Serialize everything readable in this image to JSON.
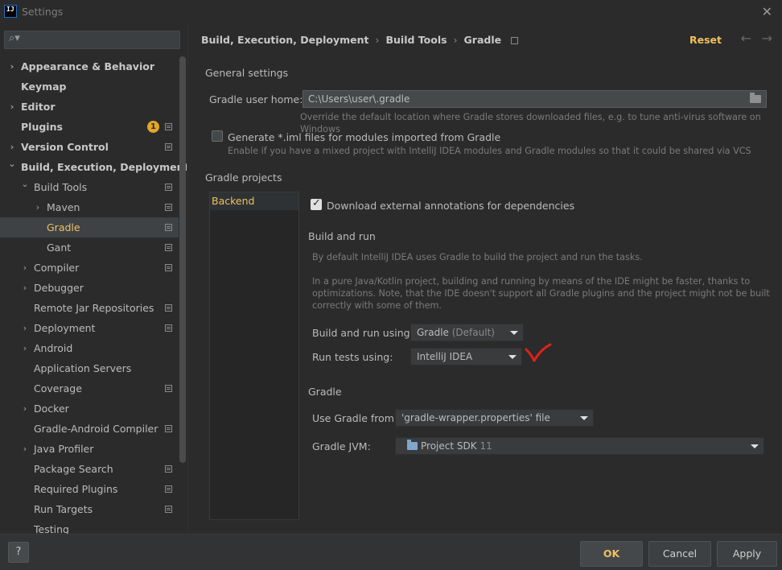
{
  "window": {
    "title": "Settings",
    "logo_text": "IJ"
  },
  "sidebar": {
    "items": [
      {
        "label": "Appearance & Behavior",
        "bold": true,
        "chevron": "right",
        "level": 0
      },
      {
        "label": "Keymap",
        "bold": true,
        "chevron": "",
        "level": 0
      },
      {
        "label": "Editor",
        "bold": true,
        "chevron": "right",
        "level": 0
      },
      {
        "label": "Plugins",
        "bold": true,
        "chevron": "",
        "level": 0,
        "badge": "1",
        "project": true
      },
      {
        "label": "Version Control",
        "bold": true,
        "chevron": "right",
        "level": 0,
        "project": true
      },
      {
        "label": "Build, Execution, Deployment",
        "bold": true,
        "chevron": "down",
        "level": 0
      },
      {
        "label": "Build Tools",
        "chevron": "down",
        "level": 1,
        "project": true
      },
      {
        "label": "Maven",
        "chevron": "right",
        "level": 2,
        "project": true
      },
      {
        "label": "Gradle",
        "chevron": "",
        "level": 2,
        "project": true,
        "selected": true
      },
      {
        "label": "Gant",
        "chevron": "",
        "level": 2,
        "project": true
      },
      {
        "label": "Compiler",
        "chevron": "right",
        "level": 1,
        "project": true
      },
      {
        "label": "Debugger",
        "chevron": "right",
        "level": 1
      },
      {
        "label": "Remote Jar Repositories",
        "chevron": "",
        "level": 1,
        "project": true
      },
      {
        "label": "Deployment",
        "chevron": "right",
        "level": 1,
        "project": true
      },
      {
        "label": "Android",
        "chevron": "right",
        "level": 1
      },
      {
        "label": "Application Servers",
        "chevron": "",
        "level": 1
      },
      {
        "label": "Coverage",
        "chevron": "",
        "level": 1,
        "project": true
      },
      {
        "label": "Docker",
        "chevron": "right",
        "level": 1
      },
      {
        "label": "Gradle-Android Compiler",
        "chevron": "",
        "level": 1,
        "project": true
      },
      {
        "label": "Java Profiler",
        "chevron": "right",
        "level": 1
      },
      {
        "label": "Package Search",
        "chevron": "",
        "level": 1,
        "project": true
      },
      {
        "label": "Required Plugins",
        "chevron": "",
        "level": 1,
        "project": true
      },
      {
        "label": "Run Targets",
        "chevron": "",
        "level": 1,
        "project": true
      },
      {
        "label": "Testing",
        "chevron": "",
        "level": 1
      }
    ]
  },
  "breadcrumb": {
    "part1": "Build, Execution, Deployment",
    "part2": "Build Tools",
    "part3": "Gradle"
  },
  "header": {
    "reset_label": "Reset"
  },
  "general": {
    "heading": "General settings",
    "user_home_label": "Gradle user home:",
    "user_home_value": "C:\\Users\\user\\.gradle",
    "user_home_hint": "Override the default location where Gradle stores downloaded files, e.g. to tune anti-virus software on Windows",
    "iml_label": "Generate *.iml files for modules imported from Gradle",
    "iml_hint": "Enable if you have a mixed project with IntelliJ IDEA modules and Gradle modules so that it could be shared via VCS"
  },
  "projects": {
    "heading": "Gradle projects",
    "list": [
      "Backend"
    ],
    "annotations_label": "Download external annotations for dependencies",
    "build_run_heading": "Build and run",
    "build_run_hint1": "By default IntelliJ IDEA uses Gradle to build the project and run the tasks.",
    "build_run_hint2_line1": "In a pure Java/Kotlin project, building and running by means of the IDE might be faster, thanks to",
    "build_run_hint2_line2": "optimizations. Note, that the IDE doesn't support all Gradle plugins and the project might not be built",
    "build_run_hint2_line3": "correctly with some of them.",
    "build_run_using_label": "Build and run using:",
    "build_run_using_value": "Gradle",
    "build_run_using_suffix": "(Default)",
    "run_tests_label": "Run tests using:",
    "run_tests_value": "IntelliJ IDEA",
    "gradle_heading": "Gradle",
    "use_gradle_from_label": "Use Gradle from:",
    "use_gradle_from_value": "'gradle-wrapper.properties' file",
    "gradle_jvm_label": "Gradle JVM:",
    "gradle_jvm_value": "Project SDK",
    "gradle_jvm_version": "11"
  },
  "footer": {
    "help_label": "?",
    "ok_label": "OK",
    "cancel_label": "Cancel",
    "apply_label": "Apply"
  },
  "colors": {
    "accent": "#f0c060",
    "annotation": "#e0201a",
    "background": "#2b2b2b"
  }
}
